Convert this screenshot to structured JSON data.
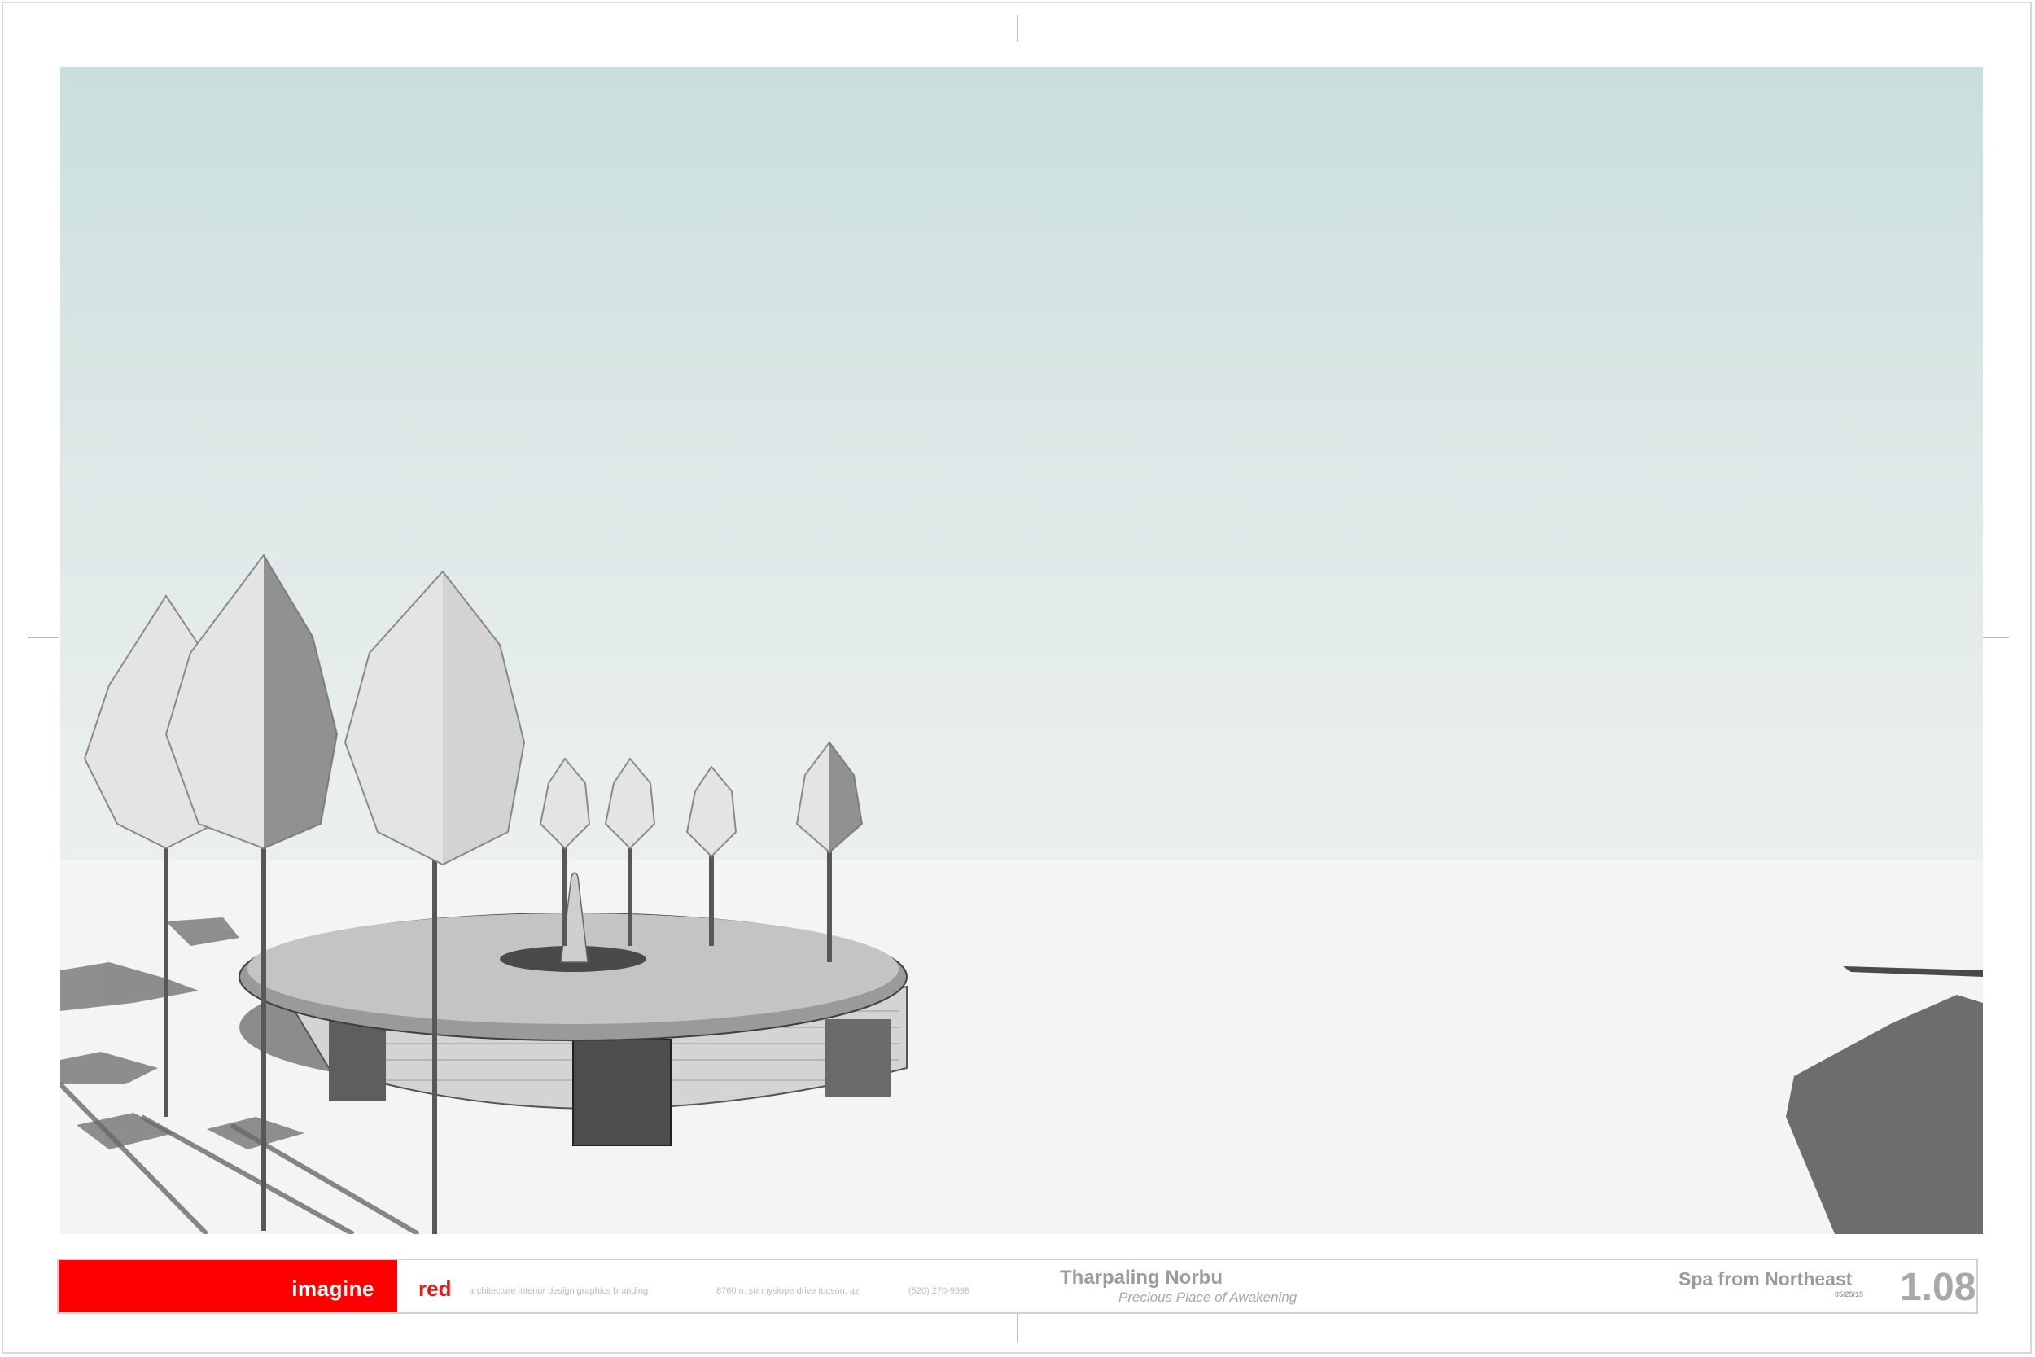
{
  "titleblock": {
    "brand_word_1": "imagine",
    "brand_word_2": "red",
    "services": "architecture   interior design   graphics   branding",
    "address": "8760 n. sunnyslope drive  tucson, az",
    "phone": "(520) 270-9998",
    "project_name": "Tharpaling Norbu",
    "project_subtitle": "Precious Place of Awakening",
    "sheet_title": "Spa from Northeast",
    "sheet_date": "05/25/15",
    "sheet_number": "1.08"
  },
  "colors": {
    "brand_red": "#ff0000",
    "sky_top": "#c9dfdc",
    "ground": "#f2f2f2",
    "shadow": "#6e6e6e"
  }
}
